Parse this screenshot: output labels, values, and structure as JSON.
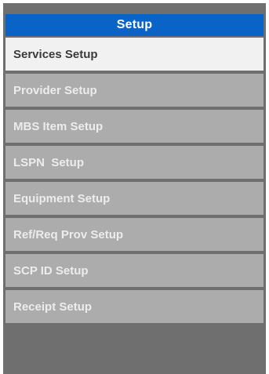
{
  "header": {
    "title": "Setup"
  },
  "menu": {
    "items": [
      {
        "label": "Services Setup",
        "active": true
      },
      {
        "label": "Provider Setup",
        "active": false
      },
      {
        "label": "MBS Item Setup",
        "active": false
      },
      {
        "label": "LSPN  Setup",
        "active": false
      },
      {
        "label": "Equipment Setup",
        "active": false
      },
      {
        "label": "Ref/Req Prov Setup",
        "active": false
      },
      {
        "label": "SCP ID Setup",
        "active": false
      },
      {
        "label": "Receipt Setup",
        "active": false
      }
    ]
  },
  "colors": {
    "header_bg": "#0a63c6",
    "panel_bg": "#6f6f6f",
    "item_bg": "#acacac",
    "active_item_bg": "#f1f1f1"
  }
}
